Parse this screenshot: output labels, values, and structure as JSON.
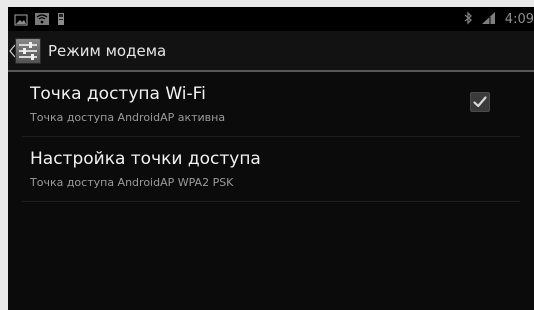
{
  "status_bar": {
    "icons": [
      "image-icon",
      "wifi-icon",
      "sd-card-icon"
    ],
    "right_icons": [
      "bluetooth-icon",
      "signal-icon"
    ],
    "time": "4:09"
  },
  "action_bar": {
    "title": "Режим модема"
  },
  "items": [
    {
      "title": "Точка доступа Wi-Fi",
      "subtitle": "Точка доступа AndroidAP активна",
      "checked": true
    },
    {
      "title": "Настройка точки доступа",
      "subtitle": "Точка доступа AndroidAP WPA2 PSK"
    }
  ],
  "colors": {
    "background": "#0b0b0b",
    "text_primary": "#f2f2f2",
    "text_secondary": "#9a9a9a"
  }
}
